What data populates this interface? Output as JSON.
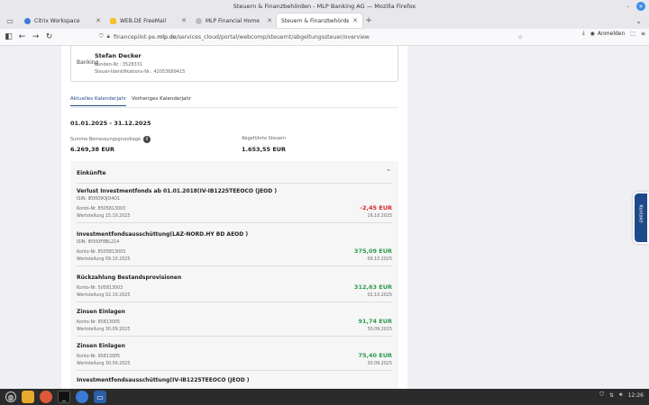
{
  "window": {
    "title": "Steuern & Finanzbehörden - MLP Banking AG — Mozilla Firefox",
    "minimize": "–",
    "close": "✕"
  },
  "tabs": [
    {
      "label": "Citrix Workspace",
      "favicon_color": "#3a7bd5"
    },
    {
      "label": "WEB.DE FreeMail",
      "favicon_color": "#f2c230"
    },
    {
      "label": "MLP Financial Home",
      "favicon_color": "#bcbcbc"
    },
    {
      "label": "Steuern & Finanzbehörden - M",
      "favicon_color": "#ffffff"
    }
  ],
  "nav": {
    "url_prefix": "financepilot-pe.",
    "url_host": "mlp.de",
    "url_path": "/services_cloud/portal/webcomp/steuernt/abgeltungssteuer/overview",
    "signin_label": "Anmelden"
  },
  "person": {
    "bank_label": "Banking",
    "name": "Stefan Decker",
    "line1": "Kunden-Nr.: 3528331",
    "line2": "Steuer-Identifikations-Nr.: 42053689415"
  },
  "year_tabs": [
    "Aktuelles Kalenderjahr",
    "Vorheriges Kalenderjahr"
  ],
  "date_range": "01.01.2025 - 31.12.2025",
  "stats": {
    "base_label": "Summe Bemessungsgrundlage",
    "base_value": "6.269,38 EUR",
    "tax_label": "Abgeführte Steuern",
    "tax_value": "1.653,55 EUR"
  },
  "income": {
    "header": "Einkünfte",
    "entries": [
      {
        "title": "Verlust Investmentfonds ab 01.01.2018(IV-IB1225TEEOCO (JEOD )",
        "isin": "ISIN: IE0009OJO4O1",
        "konto": "Konto-Nr. 8505813003",
        "amount": "-2,45 EUR",
        "wert": "Wertstellung 15.10.2025",
        "date": "16.10.2025"
      },
      {
        "title": "Investmentfondsausschüttung(LAZ-NORD.HY BD AEOD )",
        "isin": "ISIN: IE000F8BL214",
        "konto": "Konto-Nr. 8505813003",
        "amount": "375,09 EUR",
        "wert": "Wertstellung 09.10.2025",
        "date": "09.10.2025"
      },
      {
        "title": "Rückzahlung Bestandsprovisionen",
        "konto": "Konto-Nr. 505813003",
        "amount": "312,63 EUR",
        "wert": "Wertstellung 02.10.2025",
        "date": "02.10.2025"
      },
      {
        "title": "Zinsen Einlagen",
        "konto": "Konto-Nr. 85813005",
        "amount": "91,74 EUR",
        "wert": "Wertstellung 30.09.2025",
        "date": "30.09.2025"
      },
      {
        "title": "Zinsen Einlagen",
        "konto": "Konto-Nr. 95813005",
        "amount": "75,40 EUR",
        "wert": "Wertstellung 30.09.2025",
        "date": "30.09.2025"
      },
      {
        "title": "Investmentfondsausschüttung(IV-IB1225TEEOCO (JEOD )"
      }
    ]
  },
  "kontakt_label": "Kontakt",
  "clock": "12:26",
  "colors": {
    "accent": "#1f4a8a",
    "negative": "#d8272f",
    "positive": "#2c9a4c"
  }
}
